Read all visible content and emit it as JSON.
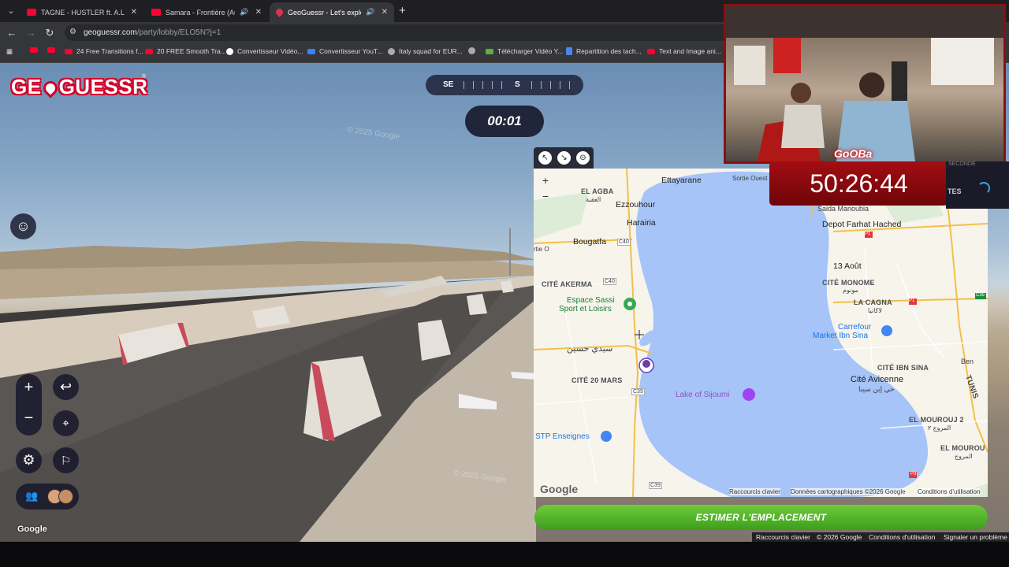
{
  "browser": {
    "tabs": [
      {
        "title": "TAGNE - HUSTLER ft. A.L.A (OFF",
        "icon": "youtube-icon",
        "active": false,
        "audio": false
      },
      {
        "title": "Samara - Frontière (Audio)",
        "icon": "youtube-icon",
        "active": false,
        "audio": true
      },
      {
        "title": "GeoGuessr - Let's explore th",
        "icon": "geoguessr-icon",
        "active": true,
        "audio": true
      }
    ],
    "url_host": "geoguessr.com",
    "url_path": "/party/lobby/ELO5N?j=1",
    "bookmarks": [
      {
        "label": "",
        "icon": "youtube-icon"
      },
      {
        "label": "",
        "icon": "youtube-icon"
      },
      {
        "label": "24 Free Transitions f...",
        "icon": "youtube-icon"
      },
      {
        "label": "20 FREE Smooth Tra...",
        "icon": "youtube-icon"
      },
      {
        "label": "Convertisseur Vidéo...",
        "icon": "google-icon"
      },
      {
        "label": "Convertisseur YouT...",
        "icon": "converter-icon"
      },
      {
        "label": "Italy squad for EUR...",
        "icon": "globe-icon"
      },
      {
        "label": "",
        "icon": "globe-icon"
      },
      {
        "label": "Télécharger Vidéo Y...",
        "icon": "download-icon"
      },
      {
        "label": "Repartition des tach...",
        "icon": "doc-icon"
      },
      {
        "label": "Text and Image ani...",
        "icon": "youtube-icon"
      }
    ]
  },
  "game": {
    "logo": "GEOGUESSR",
    "compass": {
      "left": "SE",
      "center": "S"
    },
    "timer": "00:01",
    "watermarks": [
      "© 2025 Google",
      "© 2025 Google"
    ],
    "google_label": "Google"
  },
  "map": {
    "zoom_in": "+",
    "zoom_out": "−",
    "labels": {
      "el_agba": "EL AGBA",
      "el_agba_ar": "العقبة",
      "ettayarane": "Ettayarane",
      "sortie_ouest": "Sortie Ouest",
      "ezzouhour": "Ezzouhour",
      "harairia": "Harairia",
      "bougatfa": "Bougatfa",
      "rtie_o": "rtie O",
      "c40a": "C40",
      "c40b": "C40",
      "cite_akerma": "CITÉ AKERMA",
      "espace_sassi": "Espace Sassi",
      "sport_loisirs": "Sport et Loisirs",
      "sidi_hassine_ar": "سيدي حسين",
      "cite_20_mars": "CITÉ 20 MARS",
      "c39": "C39",
      "lake": "Lake of Sijoumi",
      "stp": "STP Enseignes",
      "saida": "Saida Manoubia",
      "depot": "Depot Farhat Hached",
      "aout": "13 Août",
      "cite_monome": "CITÉ MONOME",
      "monome_ar": "مونوم",
      "cagna": "LA CAGNA",
      "cagna_ar": "لاكانيا",
      "carrefour1": "Carrefour",
      "carrefour2": "Market Ibn Sina",
      "cite_ibn_sina": "CITÉ IBN SINA",
      "ben": "Ben",
      "avicenne": "Cité Avicenne",
      "avicenne_ar": "حي إبن سينا",
      "tunis": "TUNIS",
      "el_mourouj2": "EL MOUROUJ 2",
      "el_mourouj2_ar": "المروج ٢",
      "el_mourouj": "EL MOUROU",
      "el_mourouj_ar": "المروج",
      "p1a": "P1",
      "p1b": "P1",
      "c35": "C35",
      "p3": "P3",
      "c39b": "C39"
    },
    "footer": {
      "logo": "Google",
      "shortcuts": "Raccourcis clavier",
      "data": "Données cartographiques ©2026 Google",
      "terms": "Conditions d'utilisation"
    },
    "toolbar": {
      "expand": "↖",
      "shrink": "↘",
      "pin": "⊖"
    }
  },
  "guess_button": "ESTIMER L'EMPLACEMENT",
  "page_footer": {
    "shortcuts": "Raccourcis clavier",
    "copyright": "© 2026 Google",
    "terms": "Conditions d'utilisation",
    "report": "Signaler un problème"
  },
  "stream": {
    "name": "GoOBa",
    "clock": "50:26:44",
    "strip_text": "TES",
    "seconde": "SECONDE"
  },
  "colors": {
    "brand_red": "#d4002a",
    "guess_green": "#4fb02a",
    "lake_blue": "#a6c4f7",
    "overlay_red": "#8b0f12"
  }
}
